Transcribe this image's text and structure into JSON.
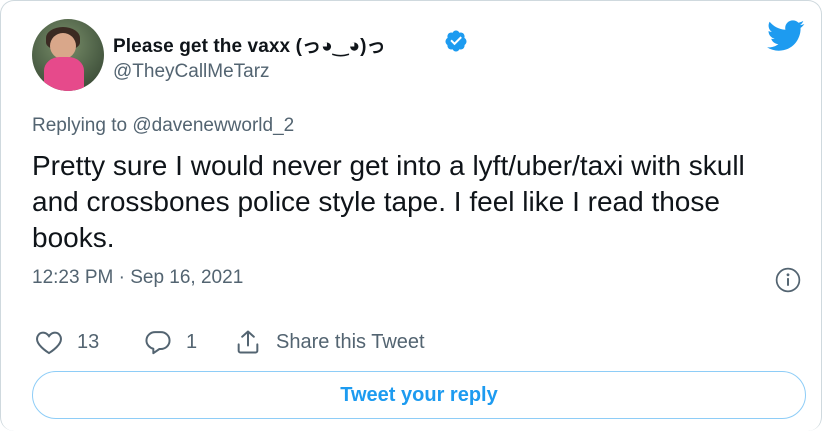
{
  "author": {
    "display_name": "Please get the vaxx (っ◕‿◕)っ",
    "handle": "@TheyCallMeTarz",
    "verified": true
  },
  "reply_to": "Replying to @davenewworld_2",
  "tweet": {
    "text": "Pretty sure I would never get into a lyft/uber/taxi with skull and crossbones police style tape. I feel like I read those books.",
    "timestamp": "12:23 PM · Sep 16, 2021"
  },
  "actions": {
    "likes": "13",
    "replies": "1",
    "share_label": "Share this Tweet"
  },
  "reply_button_label": "Tweet your reply",
  "icons": {
    "brand": "twitter-bird-icon",
    "verified": "verified-badge-icon",
    "info": "info-icon",
    "like": "heart-icon",
    "reply": "comment-icon",
    "share": "share-icon"
  },
  "colors": {
    "accent": "#1d9bf0",
    "secondary_text": "#536471",
    "primary_text": "#0f1419"
  }
}
